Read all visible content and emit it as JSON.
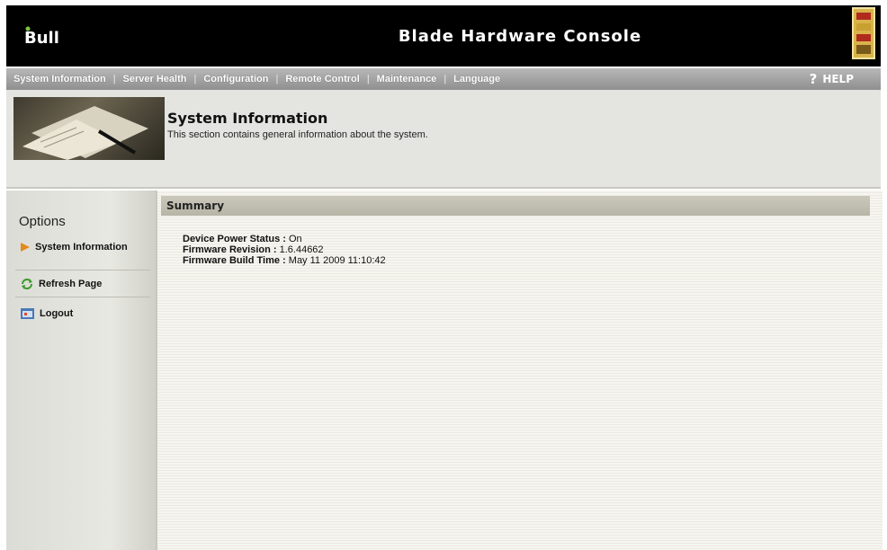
{
  "header": {
    "logo_text": "Bull",
    "title": "Blade Hardware Console"
  },
  "nav": {
    "items": [
      "System Information",
      "Server Health",
      "Configuration",
      "Remote Control",
      "Maintenance",
      "Language"
    ],
    "help_label": "HELP",
    "help_icon": "?"
  },
  "section": {
    "title": "System Information",
    "description": "This section contains general information about the system."
  },
  "sidebar": {
    "title": "Options",
    "items": [
      {
        "label": "System Information",
        "icon": "arrow-right-icon"
      },
      {
        "label": "Refresh Page",
        "icon": "refresh-icon"
      },
      {
        "label": "Logout",
        "icon": "logout-icon"
      }
    ]
  },
  "main": {
    "summary_title": "Summary",
    "fields": [
      {
        "label": "Device Power Status :",
        "value": "On"
      },
      {
        "label": "Firmware Revision :",
        "value": "1.6.44662"
      },
      {
        "label": "Firmware Build Time :",
        "value": "May 11 2009 11:10:42"
      }
    ]
  },
  "colors": {
    "header_bg": "#000000",
    "nav_bg": "#a3a3a3",
    "summary_bar": "#bfbeb0"
  }
}
